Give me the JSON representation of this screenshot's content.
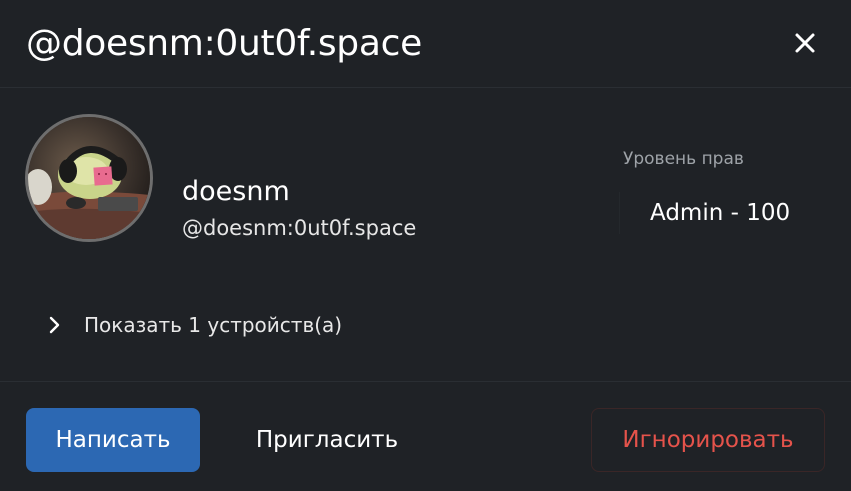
{
  "dialog": {
    "title": "@doesnm:0ut0f.space",
    "close_icon": "close-icon"
  },
  "profile": {
    "avatar_icon": "avatar-photo",
    "display_name": "doesnm",
    "user_id": "@doesnm:0ut0f.space"
  },
  "power_level": {
    "label": "Уровень прав",
    "value": "Admin - 100"
  },
  "devices": {
    "toggle_icon": "chevron-right-icon",
    "label": "Показать 1 устройств(а)"
  },
  "actions": {
    "message_label": "Написать",
    "invite_label": "Пригласить",
    "ignore_label": "Игнорировать"
  },
  "colors": {
    "background": "#1f2226",
    "primary_button": "#2c68b3",
    "danger_text": "#e5534b",
    "muted_text": "#9ea3a8"
  }
}
